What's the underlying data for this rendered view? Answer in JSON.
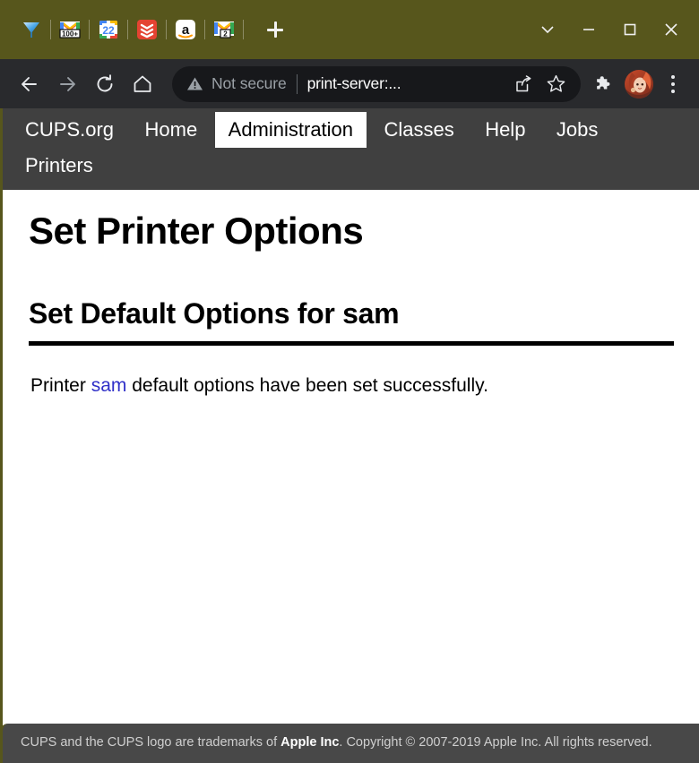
{
  "window": {
    "chrome_titlebar_color": "#57561c",
    "toolbar_color": "#292a2d",
    "tabs": [
      {
        "name": "diamond-favicon",
        "title": ""
      },
      {
        "name": "gmail-100plus-favicon",
        "title": "100+"
      },
      {
        "name": "google-calendar-22-favicon",
        "title": "22"
      },
      {
        "name": "todoist-favicon",
        "title": ""
      },
      {
        "name": "amazon-favicon",
        "title": "a"
      },
      {
        "name": "gmail-2-favicon",
        "title": "2"
      }
    ],
    "new_tab_label": "+",
    "controls": {
      "tab_search": "tab-search-chevron",
      "minimize": "minimize",
      "maximize": "maximize",
      "close": "close"
    }
  },
  "toolbar": {
    "back_label": "Back",
    "forward_label": "Forward",
    "reload_label": "Reload",
    "home_label": "Home",
    "security_status": "Not secure",
    "url": "print-server:...",
    "share_label": "Share this page",
    "bookmark_label": "Bookmark this tab",
    "extensions_label": "Extensions",
    "profile_label": "Profile",
    "menu_label": "Customize and control Google Chrome"
  },
  "cups_nav": {
    "items": [
      {
        "label": "CUPS.org",
        "active": false
      },
      {
        "label": "Home",
        "active": false
      },
      {
        "label": "Administration",
        "active": true
      },
      {
        "label": "Classes",
        "active": false
      },
      {
        "label": "Help",
        "active": false
      },
      {
        "label": "Jobs",
        "active": false
      },
      {
        "label": "Printers",
        "active": false
      }
    ]
  },
  "main": {
    "page_title": "Set Printer Options",
    "section_title": "Set Default Options for sam",
    "message": {
      "before_link": "Printer ",
      "link_text": "sam",
      "after_link": " default options have been set successfully."
    },
    "link_color": "#3030c8"
  },
  "footer": {
    "text_part1": "CUPS and the CUPS logo are trademarks of ",
    "text_bold": "Apple Inc",
    "text_part2": ". Copyright © 2007-2019 Apple Inc. All rights reserved."
  }
}
